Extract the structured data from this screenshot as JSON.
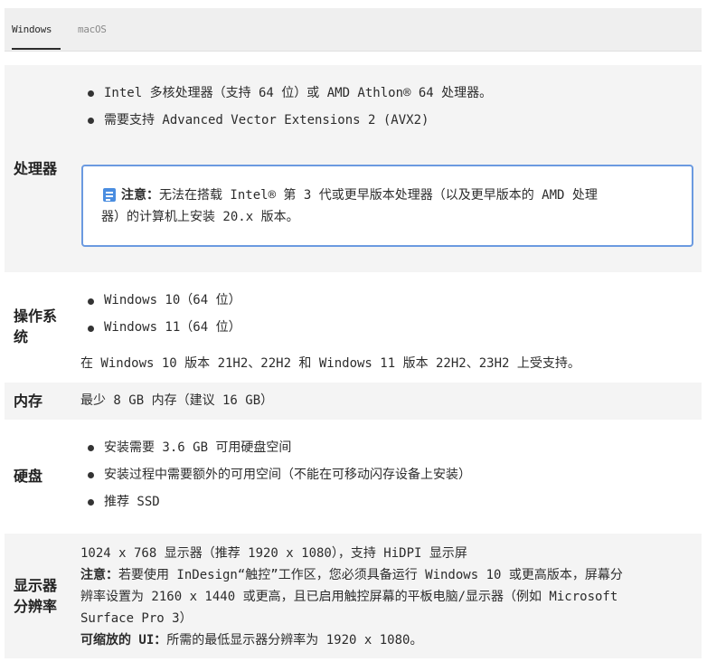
{
  "tabs": [
    {
      "label": "Windows",
      "active": true
    },
    {
      "label": "macOS",
      "active": false
    }
  ],
  "colors": {
    "accent": "#4a8de0",
    "note_border": "#6b9ae0",
    "row_gray": "#f4f4f4"
  },
  "processor": {
    "label": "处理器",
    "items": [
      "Intel 多核处理器（支持 64 位）或 AMD Athlon® 64 处理器。",
      "需要支持 Advanced Vector Extensions 2 (AVX2)"
    ],
    "note": {
      "icon": "note-icon",
      "prefix": "注意：",
      "line1": "无法在搭载 Intel® 第 3 代或更早版本处理器（以及更早版本的 AMD 处理",
      "line2": "器）的计算机上安装 20.x 版本。"
    }
  },
  "os": {
    "label_line1": "操作系",
    "label_line2": "统",
    "items": [
      "Windows 10（64 位）",
      "Windows 11（64 位）"
    ],
    "footer": "在 Windows 10 版本 21H2、22H2 和  Windows 11 版本 22H2、23H2 上受支持。"
  },
  "memory": {
    "label": "内存",
    "value": "最少 8 GB 内存（建议 16 GB）"
  },
  "disk": {
    "label": "硬盘",
    "items": [
      "安装需要 3.6 GB 可用硬盘空间",
      "安装过程中需要额外的可用空间（不能在可移动闪存设备上安装）",
      "推荐 SSD"
    ]
  },
  "display": {
    "label_line1": "显示器",
    "label_line2": "分辨率",
    "line1": "1024 x 768 显示器（推荐 1920 x 1080），支持 HiDPI 显示屏",
    "note_prefix": "注意：",
    "note_line1": "若要使用 InDesign“触控”工作区，您必须具备运行 Windows 10 或更高版本，屏幕分",
    "note_line2": "辨率设置为 2160 x 1440 或更高，且已启用触控屏幕的平板电脑/显示器（例如 Microsoft",
    "note_line3": "Surface Pro 3）",
    "scalable_prefix": "可缩放的 UI：",
    "scalable_text": "所需的最低显示器分辨率为 1920 x 1080。"
  }
}
